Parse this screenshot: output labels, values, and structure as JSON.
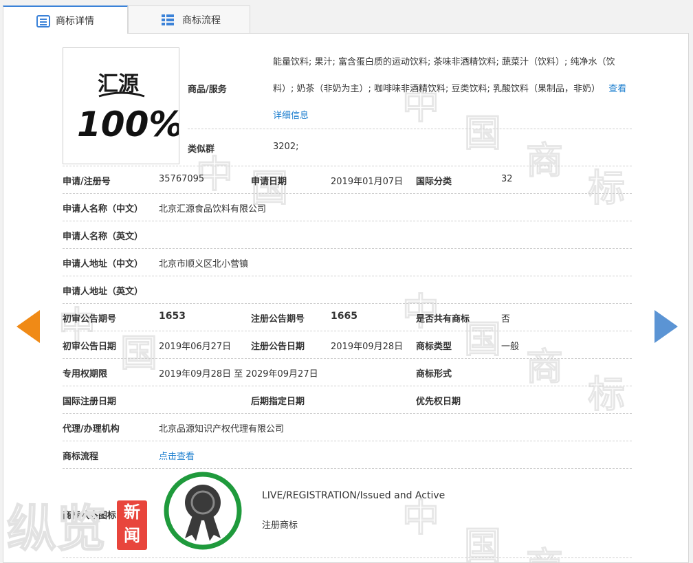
{
  "tabs": [
    {
      "label": "商标详情",
      "icon": "list-icon",
      "active": true
    },
    {
      "label": "商标流程",
      "icon": "flow-icon",
      "active": false
    }
  ],
  "logo": {
    "brand_text": "汇源",
    "number_text": "100%"
  },
  "goods": {
    "label": "商品/服务",
    "text": "能量饮料; 果汁; 富含蛋白质的运动饮料; 茶味非酒精饮料; 蔬菜汁（饮料）; 纯净水（饮料）; 奶茶（非奶为主）; 咖啡味非酒精饮料; 豆类饮料; 乳酸饮料（果制品，非奶）",
    "detail_link": "查看详细信息"
  },
  "similar_group": {
    "label": "类似群",
    "value": "3202;"
  },
  "rows": {
    "reg_no_label": "申请/注册号",
    "reg_no": "35767095",
    "app_date_label": "申请日期",
    "app_date": "2019年01月07日",
    "intl_class_label": "国际分类",
    "intl_class": "32",
    "applicant_cn_label": "申请人名称（中文）",
    "applicant_cn": "北京汇源食品饮料有限公司",
    "applicant_en_label": "申请人名称（英文）",
    "applicant_en": "",
    "address_cn_label": "申请人地址（中文）",
    "address_cn": "北京市顺义区北小营镇",
    "address_en_label": "申请人地址（英文）",
    "address_en": "",
    "prelim_no_label": "初审公告期号",
    "prelim_no": "1653",
    "reg_pub_no_label": "注册公告期号",
    "reg_pub_no": "1665",
    "shared_label": "是否共有商标",
    "shared": "否",
    "prelim_date_label": "初审公告日期",
    "prelim_date": "2019年06月27日",
    "reg_pub_date_label": "注册公告日期",
    "reg_pub_date": "2019年09月28日",
    "tm_type_label": "商标类型",
    "tm_type": "一般",
    "term_label": "专用权期限",
    "term": "2019年09月28日 至 2029年09月27日",
    "tm_form_label": "商标形式",
    "tm_form": "",
    "intl_reg_date_label": "国际注册日期",
    "intl_reg_date": "",
    "later_date_label": "后期指定日期",
    "later_date": "",
    "priority_date_label": "优先权日期",
    "priority_date": "",
    "agent_label": "代理/办理机构",
    "agent": "北京品源知识产权代理有限公司",
    "flow_label": "商标流程",
    "flow_link": "点击查看",
    "status_label": "商标状态图标",
    "status_en": "LIVE/REGISTRATION/Issued and Active",
    "status_cn": "注册商标"
  },
  "watermark": {
    "chars": [
      "中",
      "国",
      "商",
      "标"
    ],
    "news_badge": "新闻",
    "big_text": "纵览"
  },
  "colors": {
    "accent": "#3b82d8",
    "link": "#1e7fcf",
    "prev_arrow": "#f08a16",
    "next_arrow": "#5b94d4",
    "status_ring": "#1f9a3c",
    "badge": "#e8453c"
  }
}
